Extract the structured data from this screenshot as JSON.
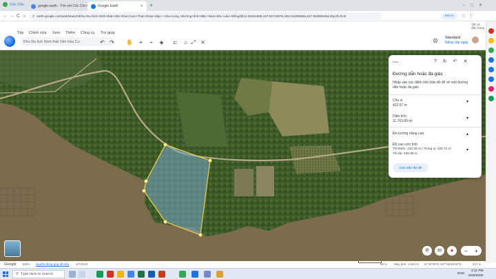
{
  "browser": {
    "brand": "Cốc Cốc",
    "tabs": [
      {
        "title": "google earth - Tìm với Cốc Cốc"
      },
      {
        "title": "Google Earth"
      }
    ],
    "new_tab": "+",
    "url": "earth.google.com/web/search/Khu+Du+lịch+Sinh+thái+Văn+hóa+Cum+Thác+Đray+Sáp+-+Gia+Long,+Đường+tỉnh+686,+Nam+Đà,+Lâm+Đồng/@12.53461595,107.94715878,435.24428659a,617.50390645d,35y,0h,0t,0r",
    "right_label": "Hỏi AI",
    "bookmarks_label": "Tất cả dấu trang",
    "nav": {
      "back": "←",
      "forward": "→",
      "reload": "C",
      "home": "⌂"
    }
  },
  "earth": {
    "menu": [
      "Tệp",
      "Chỉnh sửa",
      "Xem",
      "Thêm",
      "Công cụ",
      "Trợ giúp"
    ],
    "search_placeholder": "Khu Du lịch Sinh thái Văn hóa Cu",
    "account": {
      "plan": "Standard",
      "upgrade": "Nâng cấp ngay"
    }
  },
  "panel": {
    "title": "Đường dẫn hoặc đa giác",
    "instruction": "Nhấp vào các điểm trên bản đồ để vẽ một đường dẫn hoặc đa giác",
    "perimeter": {
      "label": "Chu vi",
      "value": "422,57 m"
    },
    "area": {
      "label": "Diện tích",
      "value": "11.703,89 m²"
    },
    "advanced_label": "Đo lường nâng cao",
    "elevation": {
      "label": "Độ cao ước tính",
      "minmid": "Tối thiểu: 410,35 m | Trung vị: 420,72 m",
      "max": "Tối đa: 430,65 m"
    },
    "save_button": "Lưu vào dự án"
  },
  "status": {
    "google": "Google",
    "zoom": "100%",
    "data_source": "Nguồn đóng góp dữ liệu",
    "date": "1/7/2024",
    "scale": "80 m",
    "camera": "Máy ảnh: 1.003 m",
    "coords": "12°32'05\"N 107°56'49.60\"E",
    "alt": "417 m"
  },
  "taskbar": {
    "search_placeholder": "Type here to search",
    "lang": "ENG",
    "time": "2:11 PM",
    "date": "6/25/2025"
  },
  "map_controls": {
    "view_3d": "3D"
  }
}
